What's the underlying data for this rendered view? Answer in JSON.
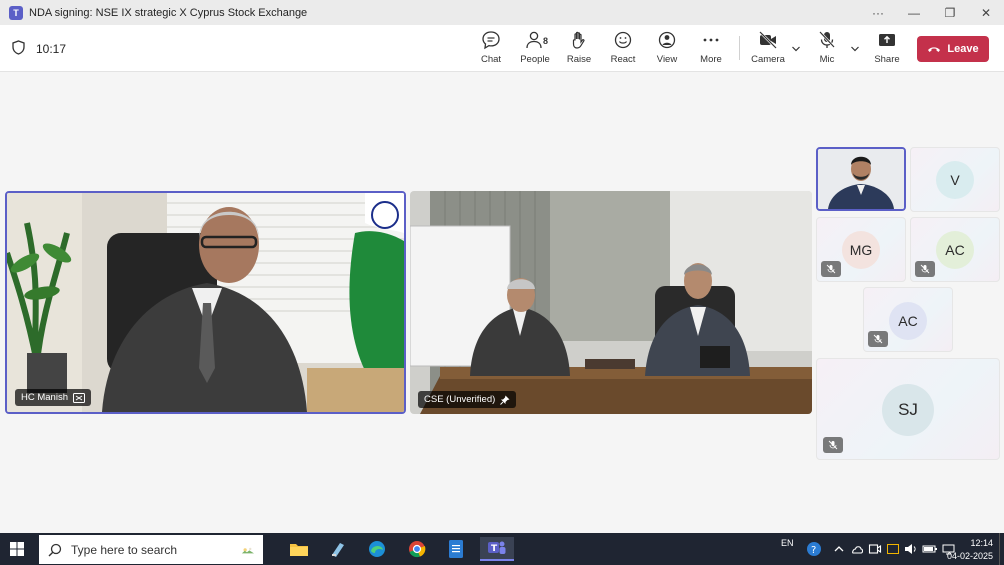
{
  "window": {
    "title": "NDA signing: NSE IX strategic X Cyprus Stock Exchange",
    "controls": {
      "more": "···",
      "minimize": "—",
      "restore": "❐",
      "close": "✕"
    }
  },
  "toolbar": {
    "timer": "10:17",
    "chat": "Chat",
    "people": "People",
    "people_count": "8",
    "raise": "Raise",
    "react": "React",
    "view": "View",
    "more": "More",
    "camera": "Camera",
    "mic": "Mic",
    "share": "Share",
    "leave": "Leave"
  },
  "stage": {
    "tiles": [
      {
        "name": "HC Manish"
      },
      {
        "name": "CSE (Unverified)"
      }
    ],
    "gallery": [
      {
        "initials": "V"
      },
      {
        "initials": "MG"
      },
      {
        "initials": "AC"
      },
      {
        "initials": "AC"
      },
      {
        "initials": "SJ"
      }
    ]
  },
  "taskbar": {
    "search_placeholder": "Type here to search",
    "language": "EN",
    "time": "12:14",
    "date": "04-02-2025"
  },
  "colors": {
    "accent": "#5b5fc7",
    "leave": "#c4314b",
    "taskbar": "#1f2532"
  }
}
